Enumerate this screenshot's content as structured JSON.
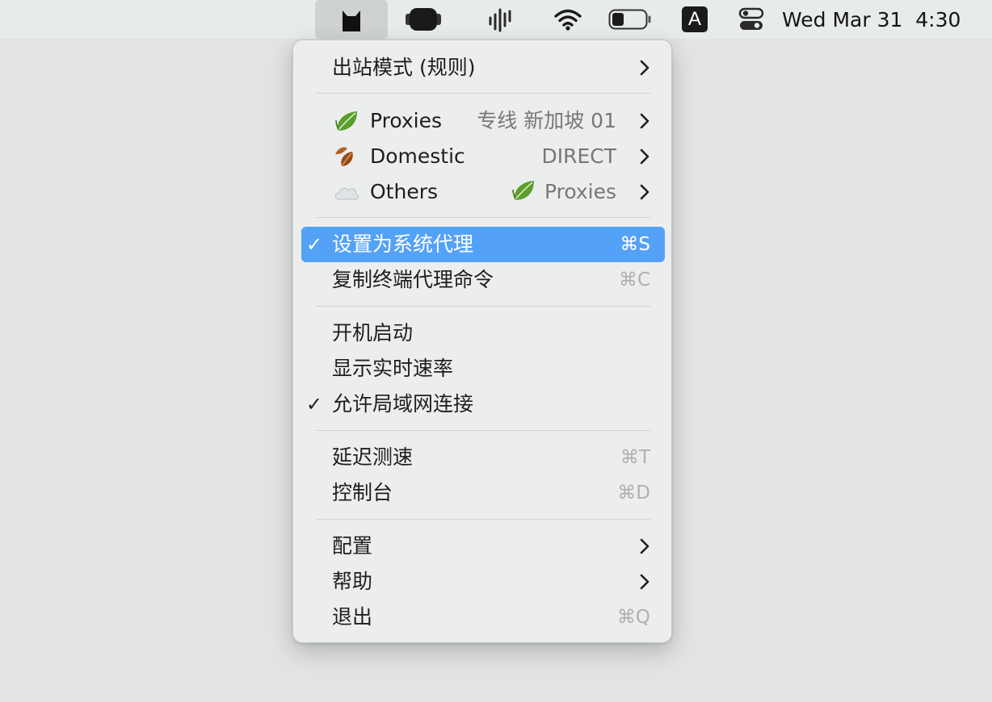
{
  "menubar": {
    "clock": "Wed Mar 31  4:30",
    "input_source": "A",
    "icons": [
      "clashx-cat-icon",
      "headset-icon",
      "audio-waveform-icon",
      "wifi-icon",
      "battery-icon",
      "input-source-icon",
      "control-center-icon"
    ],
    "battery_level": 0.35
  },
  "menu": {
    "outbound_mode": {
      "label": "出站模式 (规则)",
      "has_submenu": true
    },
    "groups": [
      {
        "icon": "leaf-icon",
        "label": "Proxies",
        "value": "专线 新加坡 01",
        "has_submenu": true
      },
      {
        "icon": "fallen-leaf-icon",
        "label": "Domestic",
        "value": "DIRECT",
        "has_submenu": true
      },
      {
        "icon": "cloud-icon",
        "label": "Others",
        "value_icon": "leaf-icon",
        "value": "Proxies",
        "has_submenu": true
      }
    ],
    "set_system_proxy": {
      "label": "设置为系统代理",
      "shortcut": "⌘S",
      "checked": true,
      "highlighted": true
    },
    "copy_terminal_cmd": {
      "label": "复制终端代理命令",
      "shortcut": "⌘C"
    },
    "launch_at_login": {
      "label": "开机启动",
      "checked": false
    },
    "show_speed": {
      "label": "显示实时速率",
      "checked": false
    },
    "allow_lan": {
      "label": "允许局域网连接",
      "checked": true
    },
    "latency_test": {
      "label": "延迟测速",
      "shortcut": "⌘T"
    },
    "dashboard": {
      "label": "控制台",
      "shortcut": "⌘D"
    },
    "config": {
      "label": "配置",
      "has_submenu": true
    },
    "help": {
      "label": "帮助",
      "has_submenu": true
    },
    "quit": {
      "label": "退出",
      "shortcut": "⌘Q"
    },
    "checkmark": "✓",
    "highlight_color": "#54a2f7"
  }
}
